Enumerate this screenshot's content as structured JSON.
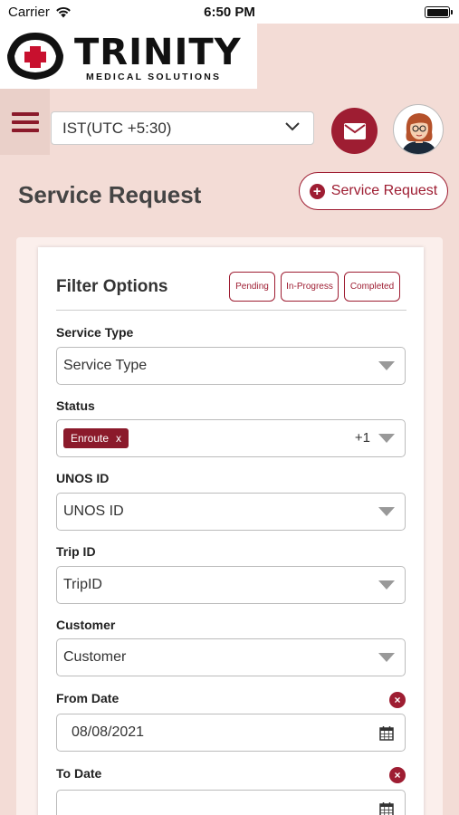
{
  "status_bar": {
    "carrier": "Carrier",
    "time": "6:50 PM"
  },
  "brand": {
    "name": "TRINITY",
    "tagline": "MEDICAL SOLUTIONS"
  },
  "header": {
    "timezone": "IST(UTC +5:30)"
  },
  "page": {
    "title": "Service Request",
    "new_button": "Service Request"
  },
  "filters": {
    "title": "Filter Options",
    "pills": [
      "Pending",
      "In-Progress",
      "Completed"
    ],
    "service_type": {
      "label": "Service Type",
      "placeholder": "Service Type"
    },
    "status": {
      "label": "Status",
      "chip": "Enroute",
      "chip_remove": "x",
      "more": "+1"
    },
    "unos_id": {
      "label": "UNOS ID",
      "placeholder": "UNOS ID"
    },
    "trip_id": {
      "label": "Trip ID",
      "placeholder": "TripID"
    },
    "customer": {
      "label": "Customer",
      "placeholder": "Customer"
    },
    "from_date": {
      "label": "From Date",
      "value": "08/08/2021"
    },
    "to_date": {
      "label": "To Date",
      "value": ""
    }
  },
  "colors": {
    "accent": "#9e1d32",
    "background": "#f3dcd6"
  },
  "icons": [
    "wifi-icon",
    "battery-icon",
    "logo-cross-icon",
    "menu-icon",
    "chevron-down-icon",
    "mail-icon",
    "avatar-icon",
    "plus-circle-icon",
    "dropdown-arrow-icon",
    "clear-icon",
    "calendar-icon"
  ]
}
